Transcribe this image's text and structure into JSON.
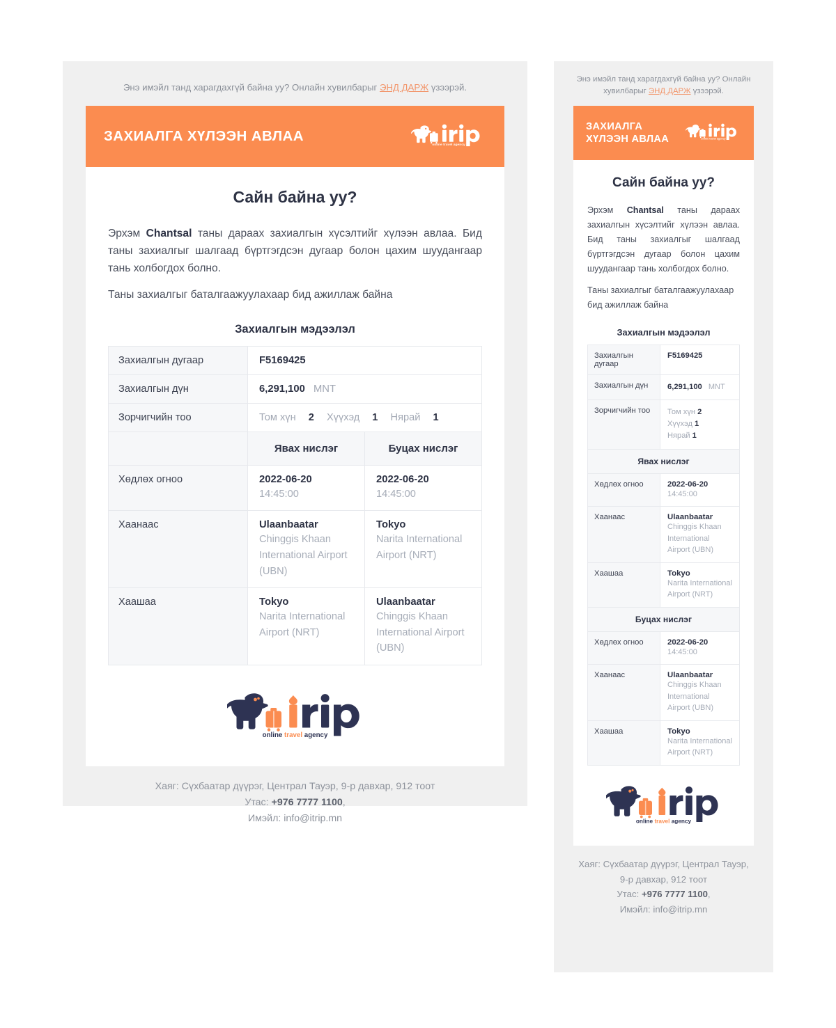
{
  "preheader": {
    "before": "Энэ имэйл танд харагдахгүй байна уу? Онлайн хувилбарыг ",
    "link": "ЭНД ДАРЖ",
    "after": " үзээрэй."
  },
  "header": {
    "title": "ЗАХИАЛГА ХҮЛЭЭН АВЛАА",
    "title_line1": "ЗАХИАЛГА",
    "title_line2": "ХҮЛЭЭН АВЛАА",
    "logo_alt": "itrip",
    "logo_tagline": "online travel agency"
  },
  "body": {
    "greeting": "Сайн байна уу?",
    "paragraph1_pre": "Эрхэм ",
    "paragraph1_name": "Chantsal",
    "paragraph1_post": " таны дараах захиалгын хүсэлтийг хүлээн авлаа. Бид таны захиалгыг шалгаад бүртгэгдсэн дугаар болон цахим шуудангаар тань холбогдох болно.",
    "paragraph2": "Таны захиалгыг баталгаажуулахаар бид ажиллаж байна",
    "section_title": "Захиалгын мэдээлэл"
  },
  "order": {
    "number_label": "Захиалгын дугаар",
    "number_value": "F5169425",
    "amount_label": "Захиалгын дүн",
    "amount_value": "6,291,100",
    "amount_currency": "MNT",
    "pax_label": "Зорчигчийн тоо",
    "pax": [
      {
        "label": "Том хүн",
        "count": "2"
      },
      {
        "label": "Хүүхэд",
        "count": "1"
      },
      {
        "label": "Нярай",
        "count": "1"
      }
    ]
  },
  "flights": {
    "outbound_header": "Явах нислэг",
    "return_header": "Буцах нислэг",
    "rows": {
      "date_label": "Хөдлөх огноо",
      "from_label": "Хаанаас",
      "to_label": "Хаашаа"
    },
    "outbound": {
      "date": "2022-06-20",
      "time": "14:45:00",
      "from_city": "Ulaanbaatar",
      "from_airport": "Chinggis Khaan International Airport (UBN)",
      "to_city": "Tokyo",
      "to_airport": "Narita International Airport (NRT)"
    },
    "return": {
      "date": "2022-06-20",
      "time": "14:45:00",
      "from_city": "Tokyo",
      "from_airport": "Narita International Airport (NRT)",
      "to_city": "Ulaanbaatar",
      "to_airport": "Chinggis Khaan International Airport (UBN)"
    },
    "return_mobile": {
      "date": "2022-06-20",
      "time": "14:45:00",
      "from_city": "Ulaanbaatar",
      "from_airport": "Chinggis Khaan International Airport (UBN)",
      "to_city": "Tokyo",
      "to_airport": "Narita International Airport (NRT)"
    }
  },
  "footer": {
    "address": "Хаяг: Сүхбаатар дүүрэг, Централ Тауэр, 9-р давхар, 912 тоот",
    "address_line1": "Хаяг: Сүхбаатар дүүрэг, Централ Тауэр,",
    "address_line2": "9-р давхар, 912 тоот",
    "phone_label": "Утас: ",
    "phone": "+976 7777 1100",
    "phone_comma": ",",
    "email_label": "Имэйл: ",
    "email": "info@itrip.mn",
    "logo_word_i": "i",
    "logo_word_trip": "trip",
    "tagline_online": "online ",
    "tagline_travel": "travel ",
    "tagline_agency": "agency"
  },
  "colors": {
    "accent_orange": "#fb8c50",
    "navy": "#2e3345",
    "muted_gray": "#a7adb8",
    "page_gray": "#f0f0f0",
    "row_gray": "#f6f7f9"
  }
}
